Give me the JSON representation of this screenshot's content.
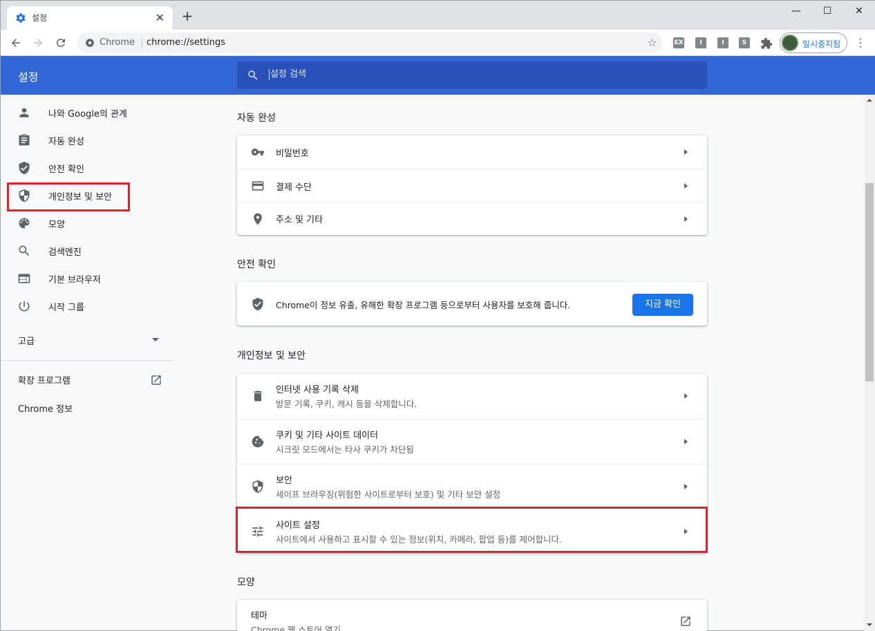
{
  "window": {
    "tab_title": "설정",
    "controls": {
      "minimize": "—",
      "maximize": "☐",
      "close": "✕"
    }
  },
  "toolbar": {
    "site_label": "Chrome",
    "separator": "|",
    "url": "chrome://settings",
    "extensions": [
      "EX",
      "I",
      "I",
      "S"
    ],
    "profile_label": "일시중지됨"
  },
  "header": {
    "title": "설정",
    "search_placeholder": "설정 검색"
  },
  "sidebar": {
    "items": [
      {
        "label": "나와 Google의 관계",
        "icon": "person-icon"
      },
      {
        "label": "자동 완성",
        "icon": "clipboard-icon"
      },
      {
        "label": "안전 확인",
        "icon": "shield-check-icon"
      },
      {
        "label": "개인정보 및 보안",
        "icon": "shield-half-icon"
      },
      {
        "label": "모양",
        "icon": "palette-icon"
      },
      {
        "label": "검색엔진",
        "icon": "search-icon"
      },
      {
        "label": "기본 브라우저",
        "icon": "browser-icon"
      },
      {
        "label": "시작 그룹",
        "icon": "power-icon"
      }
    ],
    "advanced_label": "고급",
    "extensions_label": "확장 프로그램",
    "about_label": "Chrome 정보"
  },
  "main": {
    "autofill": {
      "title": "자동 완성",
      "rows": [
        {
          "label": "비밀번호",
          "icon": "key-icon"
        },
        {
          "label": "결제 수단",
          "icon": "credit-card-icon"
        },
        {
          "label": "주소 및 기타",
          "icon": "location-pin-icon"
        }
      ]
    },
    "safety": {
      "title": "안전 확인",
      "text": "Chrome이 정보 유출, 유해한 확장 프로그램 등으로부터 사용자를 보호해 줍니다.",
      "button": "지금 확인"
    },
    "privacy": {
      "title": "개인정보 및 보안",
      "rows": [
        {
          "label": "인터넷 사용 기록 삭제",
          "sub": "방문 기록, 쿠키, 캐시 등을 삭제합니다.",
          "icon": "trash-icon"
        },
        {
          "label": "쿠키 및 기타 사이트 데이터",
          "sub": "시크릿 모드에서는 타사 쿠키가 차단됨",
          "icon": "cookie-icon"
        },
        {
          "label": "보안",
          "sub": "세이프 브라우징(위험한 사이트로부터 보호) 및 기타 보안 설정",
          "icon": "shield-half-icon"
        },
        {
          "label": "사이트 설정",
          "sub": "사이트에서 사용하고 표시할 수 있는 정보(위치, 카메라, 팝업 등)를 제어합니다.",
          "icon": "sliders-icon"
        }
      ]
    },
    "appearance": {
      "title": "모양",
      "rows": [
        {
          "label": "테마",
          "sub": "Chrome 웹 스토어 열기",
          "icon": "external-link-icon"
        }
      ]
    }
  },
  "colors": {
    "header_bg": "#3367d6",
    "search_bg": "#2852b8",
    "primary_button": "#1a73e8",
    "highlight_box": "#e0202e"
  }
}
